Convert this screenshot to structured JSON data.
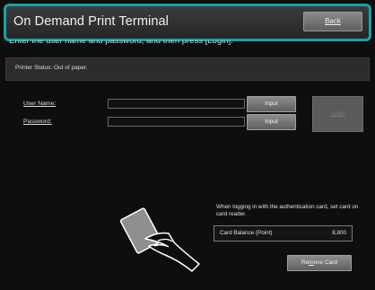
{
  "header": {
    "title": "On Demand Print Terminal",
    "back_label": "Back"
  },
  "instruction": "Enter the user name and password, and then press [Login].",
  "status": {
    "text": "Printer Status: Out of paper."
  },
  "login": {
    "user_label": "User Name:",
    "password_label": "Password:",
    "user_value": "",
    "password_value": "",
    "input_label_user": "Input",
    "input_label_password": "Input",
    "login_label": "Login"
  },
  "card": {
    "note": "When logging in with the authentication card, set card on card reader.",
    "balance_label": "Card Balance (Point)",
    "balance_value": "8,800",
    "remove_prefix": "Re",
    "remove_underlined": "m",
    "remove_suffix": "ove Card",
    "illustration_icon": "hand-holding-card-icon"
  },
  "colors": {
    "accent": "#17a3a3",
    "background": "#0e0e0e"
  }
}
